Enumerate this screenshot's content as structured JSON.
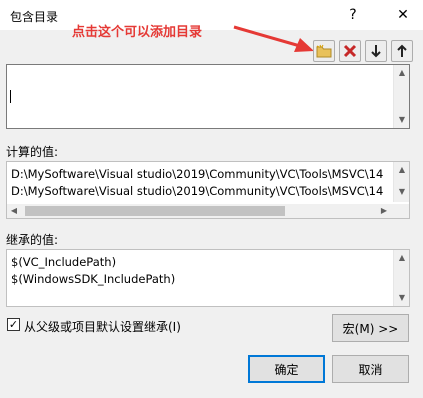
{
  "window": {
    "title": "包含目录",
    "help_label": "?",
    "close_label": "✕"
  },
  "annotation": {
    "text": "点击这个可以添加目录",
    "color": "#e53935"
  },
  "toolbar": {
    "icons": [
      "new-folder-icon",
      "delete-icon",
      "move-down-icon",
      "move-up-icon"
    ]
  },
  "computed": {
    "label": "计算的值:",
    "lines": [
      "D:\\MySoftware\\Visual studio\\2019\\Community\\VC\\Tools\\MSVC\\14",
      "D:\\MySoftware\\Visual studio\\2019\\Community\\VC\\Tools\\MSVC\\14"
    ]
  },
  "inherited": {
    "label": "继承的值:",
    "lines": [
      "$(VC_IncludePath)",
      "$(WindowsSDK_IncludePath)"
    ]
  },
  "inherit_checkbox": {
    "label": "从父级或项目默认设置继承(I)",
    "checked": true
  },
  "buttons": {
    "macros": "宏(M) >>",
    "ok": "确定",
    "cancel": "取消"
  },
  "colors": {
    "accent": "#0078d7",
    "annotation": "#e53935"
  }
}
